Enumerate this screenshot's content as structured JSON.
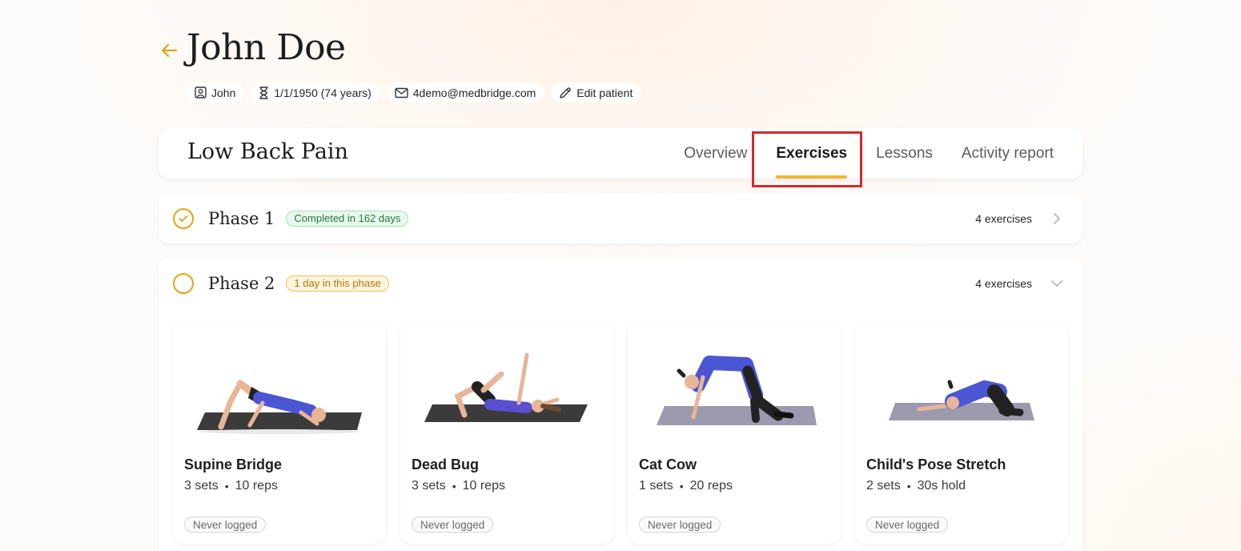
{
  "patient": {
    "name": "John Doe",
    "chips": {
      "first_name": "John",
      "dob": "1/1/1950 (74 years)",
      "email": "4demo@medbridge.com",
      "edit": "Edit patient"
    }
  },
  "condition": {
    "title": "Low Back Pain",
    "tabs": [
      {
        "label": "Overview"
      },
      {
        "label": "Exercises"
      },
      {
        "label": "Lessons"
      },
      {
        "label": "Activity report"
      }
    ],
    "active_tab": "Exercises"
  },
  "phases": [
    {
      "title": "Phase 1",
      "badge": "Completed in 162 days",
      "count": "4 exercises",
      "status": "completed"
    },
    {
      "title": "Phase 2",
      "badge": "1 day in this phase",
      "count": "4 exercises",
      "status": "in-progress",
      "exercises": [
        {
          "name": "Supine Bridge",
          "sets": "3 sets",
          "amount": "10 reps",
          "log": "Never logged"
        },
        {
          "name": "Dead Bug",
          "sets": "3 sets",
          "amount": "10 reps",
          "log": "Never logged"
        },
        {
          "name": "Cat Cow",
          "sets": "1 sets",
          "amount": "20 reps",
          "log": "Never logged"
        },
        {
          "name": "Child's Pose Stretch",
          "sets": "2 sets",
          "amount": "30s hold",
          "log": "Never logged"
        }
      ]
    }
  ],
  "colors": {
    "accent": "#f2b632",
    "status_ring": "#e0a414",
    "highlight": "#d42a2a",
    "mat_dark": "#3b3b3b",
    "mat_lavender": "#9d9aad",
    "shirt": "#4a56d4"
  }
}
